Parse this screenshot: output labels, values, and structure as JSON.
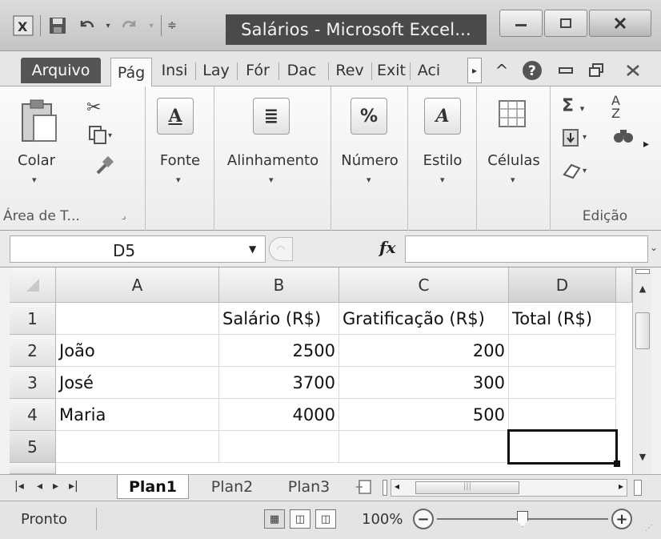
{
  "window": {
    "title": "Salários - Microsoft Excel...",
    "minimize_icon": "minimize-icon",
    "maximize_icon": "restore-icon",
    "close_icon": "close-icon"
  },
  "quick_access": [
    "excel-logo-icon",
    "save-icon",
    "undo-icon",
    "redo-icon",
    "customize-icon"
  ],
  "tabs": [
    {
      "label": "Arquivo",
      "type": "file"
    },
    {
      "label": "Pág",
      "active": true
    },
    {
      "label": "Insi"
    },
    {
      "label": "Lay"
    },
    {
      "label": "Fór"
    },
    {
      "label": "Dac"
    },
    {
      "label": "Rev"
    },
    {
      "label": "Exit"
    },
    {
      "label": "Aci"
    }
  ],
  "ribbon": {
    "clipboard": {
      "paste_label": "Colar",
      "group_label": "Área de T..."
    },
    "font": {
      "label": "Fonte"
    },
    "alignment": {
      "label": "Alinhamento"
    },
    "number": {
      "label": "Número"
    },
    "style": {
      "label": "Estilo"
    },
    "cells": {
      "label": "Células"
    },
    "editing": {
      "group_label": "Edição"
    }
  },
  "formula_bar": {
    "name_box": "D5",
    "fx": "fx",
    "formula": ""
  },
  "grid": {
    "columns": [
      "A",
      "B",
      "C",
      "D"
    ],
    "rows": [
      "1",
      "2",
      "3",
      "4",
      "5"
    ],
    "cells": [
      [
        "",
        "Salário (R$)",
        "Gratificação (R$)",
        "Total (R$)"
      ],
      [
        "João",
        "2500",
        "200",
        ""
      ],
      [
        "José",
        "3700",
        "300",
        ""
      ],
      [
        "Maria",
        "4000",
        "500",
        ""
      ],
      [
        "",
        "",
        "",
        ""
      ]
    ],
    "selected_cell": "D5"
  },
  "sheets": [
    {
      "label": "Plan1",
      "active": true
    },
    {
      "label": "Plan2"
    },
    {
      "label": "Plan3"
    }
  ],
  "status": {
    "ready": "Pronto",
    "zoom": "100%",
    "zoom_fraction": 0.5
  }
}
